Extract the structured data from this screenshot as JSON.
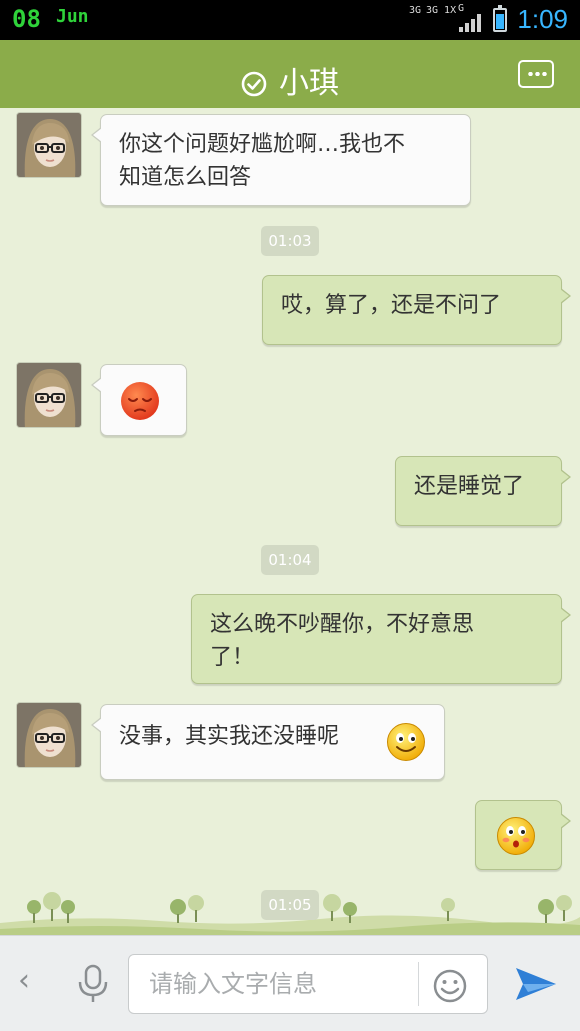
{
  "status_bar": {
    "date_day": "08",
    "date_month": "Jun",
    "network_1": "3G",
    "network_2": "3G 1X",
    "network_3": "G",
    "time": "1:09",
    "battery_level": 0.75
  },
  "header": {
    "title": "小琪",
    "online_icon": "check-circle-icon",
    "menu_icon": "more-dots-icon"
  },
  "messages": [
    {
      "direction": "in",
      "text": "你这个问题好尴尬啊…我也不\n知道怎么回答"
    },
    {
      "type": "time",
      "text": "01:03"
    },
    {
      "direction": "out",
      "text": "哎，算了，还是不问了"
    },
    {
      "direction": "in",
      "emoji": "sad-face-emoji"
    },
    {
      "direction": "out",
      "text": "还是睡觉了"
    },
    {
      "type": "time",
      "text": "01:04"
    },
    {
      "direction": "out",
      "text": "这么晚不吵醒你，不好意思\n了！"
    },
    {
      "direction": "in",
      "text": "没事，其实我还没睡呢",
      "emoji": "smile-face-emoji"
    },
    {
      "direction": "out",
      "emoji": "blush-face-emoji"
    },
    {
      "type": "time",
      "text": "01:05"
    }
  ],
  "input_bar": {
    "placeholder": "请输入文字信息",
    "back_icon": "chevron-left-icon",
    "mic_icon": "microphone-icon",
    "emoji_icon": "smiley-icon",
    "send_icon": "paper-plane-icon"
  },
  "colors": {
    "header": "#8bac4a",
    "chat_bg": "#e9f0d9",
    "bubble_out": "#d7e6b7",
    "bubble_in": "#fbfbfb",
    "clock": "#38b6ff",
    "date": "#2fd33a",
    "send": "#2f7fd6"
  }
}
